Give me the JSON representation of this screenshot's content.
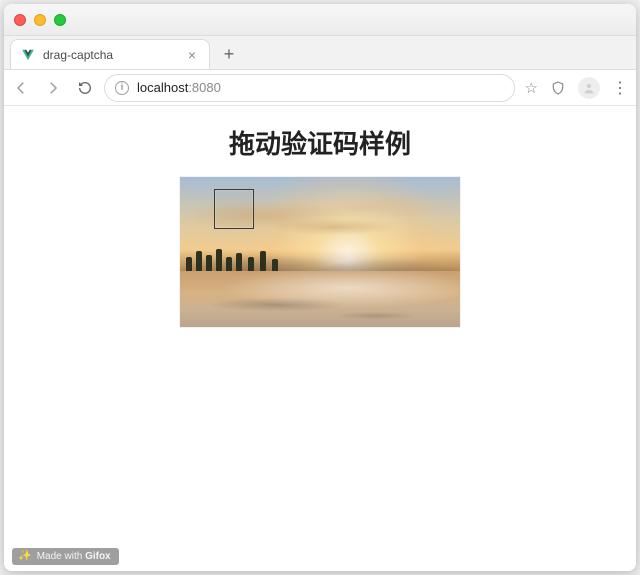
{
  "tab": {
    "title": "drag-captcha",
    "favicon_name": "vue-logo-icon"
  },
  "address": {
    "host": "localhost",
    "port": ":8080"
  },
  "page": {
    "heading": "拖动验证码样例"
  },
  "captcha": {
    "slot_aria": "drag-target-slot"
  },
  "watermark": {
    "prefix": "Made with ",
    "brand": "Gifox"
  }
}
